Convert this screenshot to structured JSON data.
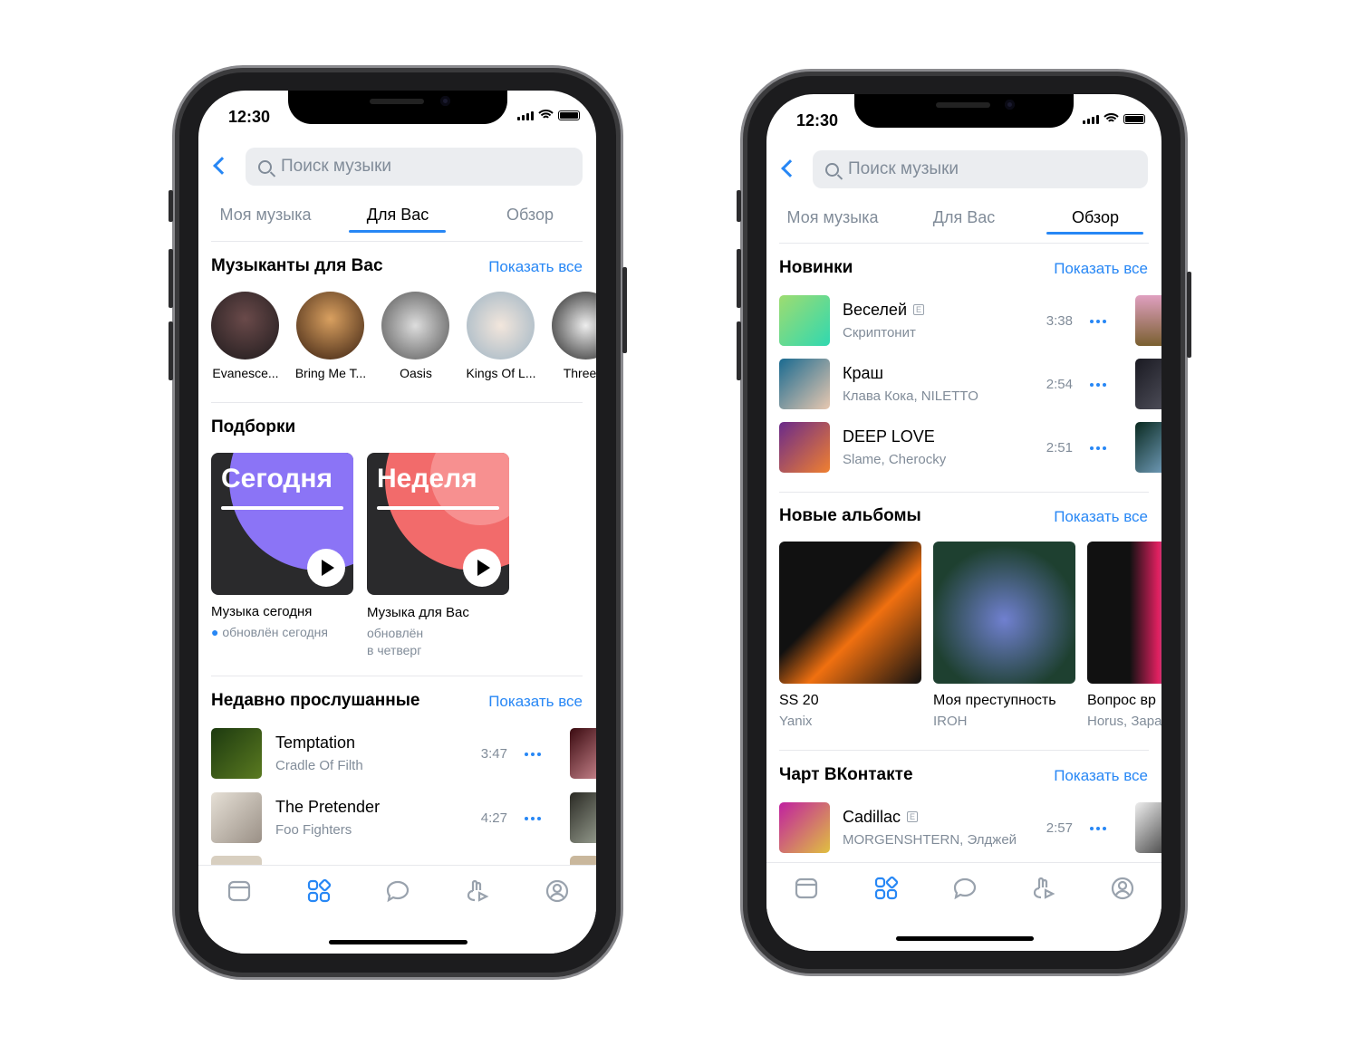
{
  "colors": {
    "accent": "#2787f5",
    "secondary": "#818c99"
  },
  "status_time": "12:30",
  "search_placeholder": "Поиск музыки",
  "tabs": [
    "Моя музыка",
    "Для Вас",
    "Обзор"
  ],
  "show_all": "Показать все",
  "left_phone": {
    "active_tab": "Для Вас",
    "artists_title": "Музыканты для Вас",
    "artists": [
      "Evanesce...",
      "Bring Me T...",
      "Oasis",
      "Kings Of L...",
      "Three D"
    ],
    "playlists_title": "Подборки",
    "playlists": [
      {
        "cover_text": "Сегодня",
        "title": "Музыка сегодня",
        "subtitle": "обновлён сегодня",
        "line2": ""
      },
      {
        "cover_text": "Неделя",
        "title": "Музыка для Вас",
        "subtitle": "обновлён",
        "line2": "в четверг"
      }
    ],
    "recent_title": "Недавно прослушанные",
    "recent": [
      {
        "title": "Temptation",
        "artist": "Cradle Of Filth",
        "duration": "3:47"
      },
      {
        "title": "The Pretender",
        "artist": "Foo Fighters",
        "duration": "4:27"
      }
    ]
  },
  "right_phone": {
    "active_tab": "Обзор",
    "new_title": "Новинки",
    "new_tracks": [
      {
        "title": "Веселей",
        "explicit": "E",
        "artist": "Скриптонит",
        "duration": "3:38"
      },
      {
        "title": "Краш",
        "explicit": "",
        "artist": "Клава Кока, NILETTO",
        "duration": "2:54"
      },
      {
        "title": "DEEP LOVE",
        "explicit": "",
        "artist": "Slame, Cherocky",
        "duration": "2:51"
      }
    ],
    "albums_title": "Новые альбомы",
    "albums": [
      {
        "title": "SS 20",
        "artist": "Yanix"
      },
      {
        "title": "Моя преступность",
        "artist": "IROH"
      },
      {
        "title": "Вопрос вр",
        "artist": "Horus, Зара"
      }
    ],
    "chart_title": "Чарт ВКонтакте",
    "chart": [
      {
        "title": "Cadillac",
        "explicit": "E",
        "artist": "MORGENSHTERN, Элджей",
        "duration": "2:57"
      }
    ]
  },
  "tabbar_icons": [
    "news-icon",
    "services-icon",
    "messages-icon",
    "clips-icon",
    "profile-icon"
  ]
}
